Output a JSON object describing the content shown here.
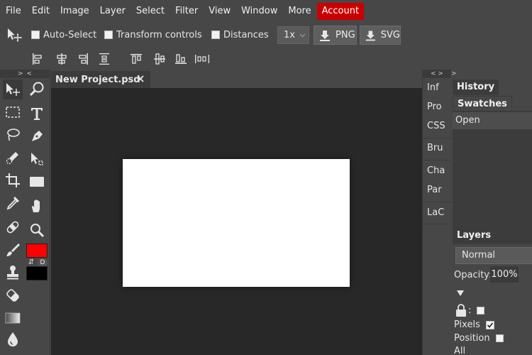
{
  "menu": {
    "items": [
      "File",
      "Edit",
      "Image",
      "Layer",
      "Select",
      "Filter",
      "View",
      "Window",
      "More"
    ],
    "account_label": "Account",
    "account_color": "#cc0000"
  },
  "options": {
    "auto_select": "Auto-Select",
    "transform_controls": "Transform controls",
    "distances": "Distances",
    "zoom_value": "1x",
    "export_png": "PNG",
    "export_svg": "SVG"
  },
  "toolbox": {
    "collapse": "> <",
    "foreground_color": "#ff0000",
    "background_color": "#000000",
    "swap_label": "⇵",
    "default_label": "D"
  },
  "document": {
    "tab_title": "New Project.psd",
    "canvas_color": "#ffffff"
  },
  "tabstrip": {
    "collapse": "< >",
    "items": [
      "Inf",
      "Pro",
      "CSS",
      "Bru",
      "Cha",
      "Par",
      "LaC"
    ]
  },
  "right_panel": {
    "collapse": ">",
    "history_tab": "History",
    "swatches_tab": "Swatches",
    "history_items": [
      "Open"
    ],
    "layers_tab": "Layers",
    "blend_mode": "Normal",
    "opacity_label": "Opacity:",
    "opacity_value": "100%",
    "lock_colon": ":",
    "pixels_label": "Pixels",
    "position_label": "Position",
    "all_label": "All"
  }
}
